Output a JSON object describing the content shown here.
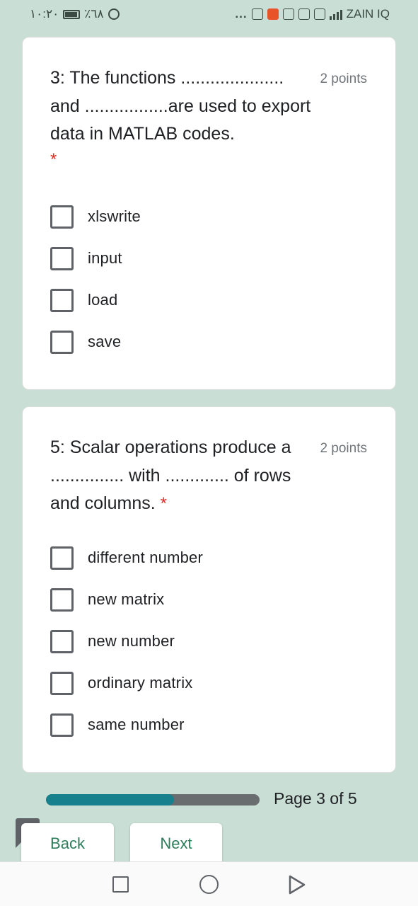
{
  "status_bar": {
    "time": "١٠:٢٠",
    "battery_percent": "٪٦٨",
    "dots": "...",
    "carrier": "ZAIN IQ"
  },
  "questions": [
    {
      "title": "3: The functions ..................... and .................are used to export data in MATLAB codes.",
      "points": "2 points",
      "required_marker": "*",
      "options": [
        "xlswrite",
        "input",
        "load",
        "save"
      ]
    },
    {
      "title": "5: Scalar operations produce a ............... with ............. of rows and columns.",
      "points": "2 points",
      "required_marker": "*",
      "options": [
        "different number",
        "new matrix",
        "new number",
        "ordinary matrix",
        "same number"
      ]
    }
  ],
  "progress": {
    "fraction": 0.6,
    "page_text": "Page 3 of 5"
  },
  "buttons": {
    "back": "Back",
    "next": "Next"
  },
  "report_icon_glyph": "!",
  "colors": {
    "background": "#c9dfd6",
    "progress_fill": "#17808d",
    "button_text": "#2e7d5b",
    "required": "#d93025"
  }
}
